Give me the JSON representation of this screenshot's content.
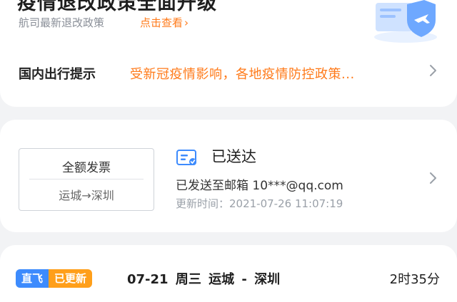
{
  "banner": {
    "title": "疫情退改政策全面升级",
    "subtitle": "航司最新退改政策",
    "link_label": "点击查看",
    "link_arrow": "›"
  },
  "notice": {
    "label": "国内出行提示",
    "text": "受新冠疫情影响，各地疫情防控政策..."
  },
  "invoice": {
    "type": "全额发票",
    "route": "运城→深圳",
    "status": "已送达",
    "sent_to": "已发送至邮箱 10***@qq.com",
    "update_time": "更新时间：2021-07-26 11:07:19"
  },
  "flight": {
    "tags": [
      "直飞",
      "已更新"
    ],
    "info": "07-21 周三 运城 - 深圳",
    "duration": "2时35分"
  },
  "colors": {
    "accent_orange": "#ff7a1a",
    "tag_blue": "#3d8bfd",
    "tag_orange": "#ff9f1a",
    "background": "#f2f3f5",
    "card": "#ffffff"
  },
  "icons": [
    "shield-plane-illustration",
    "chevron-right-icon",
    "invoice-mail-icon"
  ]
}
